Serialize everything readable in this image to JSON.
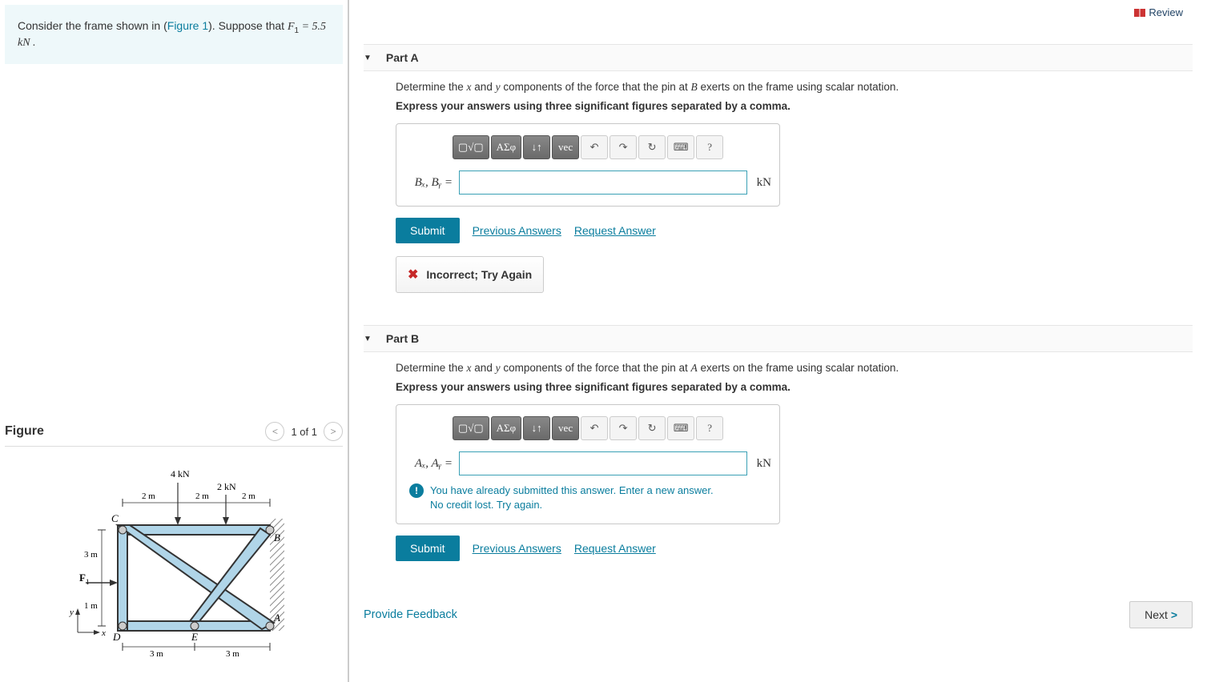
{
  "left": {
    "problem_prefix": "Consider the frame shown in (",
    "figure_link": "Figure 1",
    "problem_mid": "). Suppose that ",
    "problem_var": "F",
    "problem_sub": "1",
    "problem_eq": " = 5.5 kN .",
    "figure_title": "Figure",
    "figure_counter": "1 of 1"
  },
  "review_label": "Review",
  "parts": {
    "A": {
      "title": "Part A",
      "prompt_a": "Determine the ",
      "prompt_x": "x",
      "prompt_b": " and ",
      "prompt_y": "y",
      "prompt_c": " components of the force that the pin at ",
      "prompt_pin": "B",
      "prompt_d": " exerts on the frame using scalar notation.",
      "instruction": "Express your answers using three significant figures separated by a comma.",
      "var_label": "Bₓ, Bᵧ =",
      "unit": "kN",
      "submit": "Submit",
      "prev_ans": "Previous Answers",
      "req_ans": "Request Answer",
      "feedback": "Incorrect; Try Again"
    },
    "B": {
      "title": "Part B",
      "prompt_a": "Determine the ",
      "prompt_x": "x",
      "prompt_b": " and ",
      "prompt_y": "y",
      "prompt_c": " components of the force that the pin at ",
      "prompt_pin": "A",
      "prompt_d": " exerts on the frame using scalar notation.",
      "instruction": "Express your answers using three significant figures separated by a comma.",
      "var_label": "Aₓ, Aᵧ =",
      "unit": "kN",
      "inline_msg_1": "You have already submitted this answer. Enter a new answer.",
      "inline_msg_2": "No credit lost. Try again.",
      "submit": "Submit",
      "prev_ans": "Previous Answers",
      "req_ans": "Request Answer"
    }
  },
  "toolbar": {
    "b1": "▢√▢",
    "b2": "ΑΣφ",
    "b3": "↓↑",
    "b4": "vec",
    "b5": "↶",
    "b6": "↷",
    "b7": "↻",
    "b8": "⌨",
    "b9": "?"
  },
  "footer": {
    "provide_feedback": "Provide Feedback",
    "next": "Next"
  },
  "fig_labels": {
    "f4": "4 kN",
    "f2": "2 kN",
    "d1": "2 m",
    "d2": "2 m",
    "d3": "2 m",
    "h1": "3 m",
    "h2": "1 m",
    "w1": "3 m",
    "w2": "3 m",
    "C": "C",
    "B": "B",
    "D": "D",
    "E": "E",
    "A": "A",
    "F1": "F",
    "F1sub": "1",
    "xaxis": "x",
    "yaxis": "y"
  }
}
